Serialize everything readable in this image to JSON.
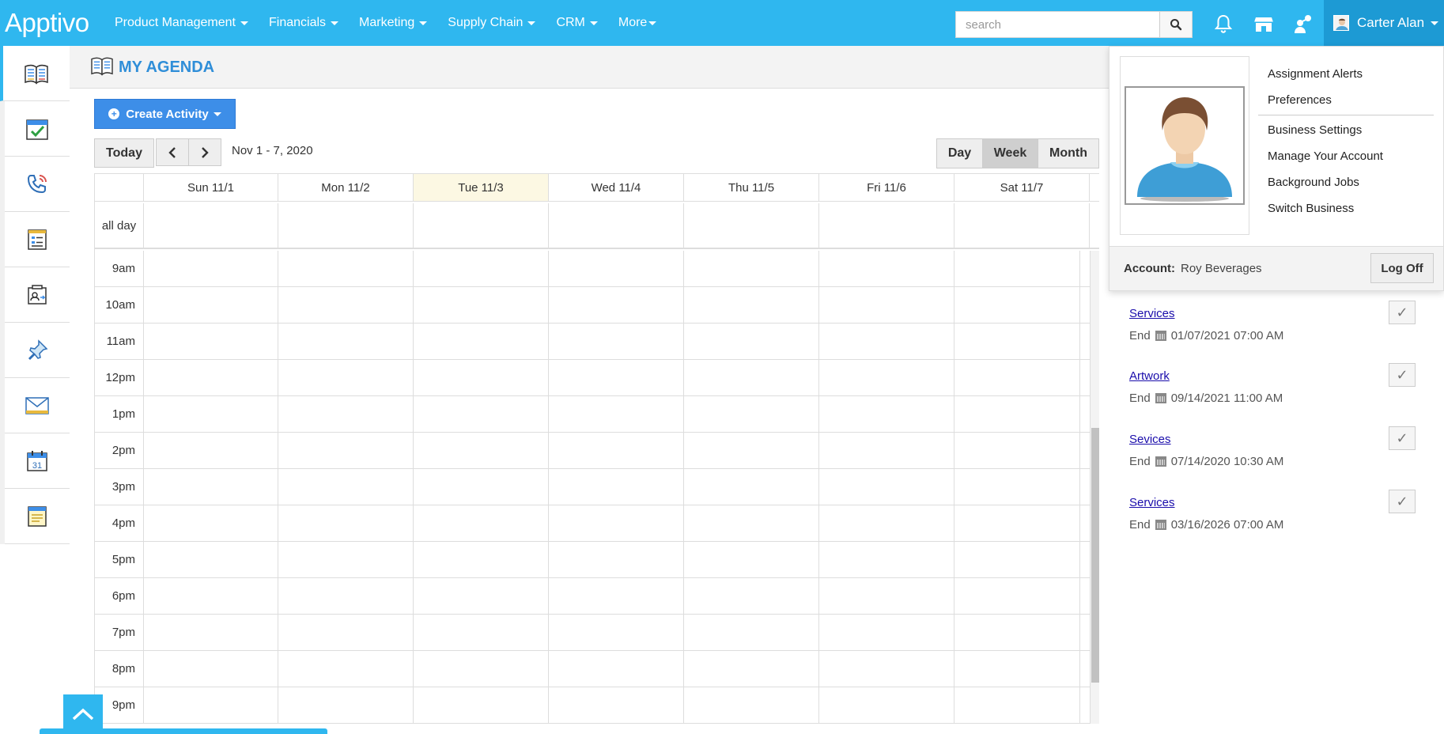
{
  "app": {
    "logo": "Apptivo"
  },
  "nav": [
    {
      "label": "Product Management"
    },
    {
      "label": "Financials"
    },
    {
      "label": "Marketing"
    },
    {
      "label": "Supply Chain"
    },
    {
      "label": "CRM"
    },
    {
      "label": "More"
    }
  ],
  "search": {
    "placeholder": "search",
    "value": ""
  },
  "user": {
    "name": "Carter Alan"
  },
  "page": {
    "title": "MY AGENDA"
  },
  "toolbar": {
    "create_label": "Create Activity",
    "today_label": "Today",
    "date_range": "Nov 1 - 7, 2020",
    "views": [
      {
        "label": "Day",
        "active": false
      },
      {
        "label": "Week",
        "active": true
      },
      {
        "label": "Month",
        "active": false
      }
    ]
  },
  "calendar": {
    "days": [
      {
        "label": "Sun 11/1",
        "today": false
      },
      {
        "label": "Mon 11/2",
        "today": false
      },
      {
        "label": "Tue 11/3",
        "today": true
      },
      {
        "label": "Wed 11/4",
        "today": false
      },
      {
        "label": "Thu 11/5",
        "today": false
      },
      {
        "label": "Fri 11/6",
        "today": false
      },
      {
        "label": "Sat 11/7",
        "today": false
      }
    ],
    "allday_label": "all day",
    "hours": [
      "9am",
      "10am",
      "11am",
      "12pm",
      "1pm",
      "2pm",
      "3pm",
      "4pm",
      "5pm",
      "6pm",
      "7pm",
      "8pm",
      "9pm"
    ]
  },
  "user_dropdown": {
    "menu": [
      {
        "label": "Assignment Alerts"
      },
      {
        "label": "Preferences"
      },
      {
        "label": "Business Settings"
      },
      {
        "label": "Manage Your Account"
      },
      {
        "label": "Background Jobs"
      },
      {
        "label": "Switch Business"
      }
    ],
    "account_label": "Account:",
    "account_value": "Roy Beverages",
    "logoff_label": "Log Off"
  },
  "tasks": [
    {
      "title": "Services",
      "end_label": "End",
      "end": "01/07/2021 07:00 AM"
    },
    {
      "title": "Artwork",
      "end_label": "End",
      "end": "09/14/2021 11:00 AM"
    },
    {
      "title": "Sevices",
      "end_label": "End",
      "end": "07/14/2020 10:30 AM"
    },
    {
      "title": "Services",
      "end_label": "End",
      "end": "03/16/2026 07:00 AM"
    }
  ],
  "colors": {
    "brand": "#2fb7ef",
    "brand_dark": "#1d9ad4",
    "title": "#2f8ed8",
    "today_col": "#fcf8e3",
    "button_primary": "#3d8ee8"
  }
}
